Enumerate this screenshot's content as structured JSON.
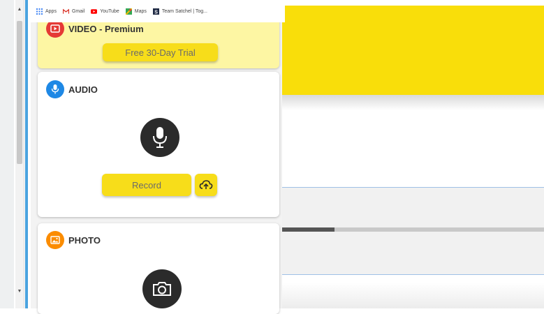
{
  "bookmarks": [
    {
      "label": "Apps",
      "icon": "apps-grid-icon",
      "color": "#4285f4"
    },
    {
      "label": "Gmail",
      "icon": "gmail-icon",
      "color": "#d93025"
    },
    {
      "label": "YouTube",
      "icon": "youtube-icon",
      "color": "#ff0000"
    },
    {
      "label": "Maps",
      "icon": "maps-icon",
      "color": "#34a853"
    },
    {
      "label": "Team Satchel | Tog...",
      "icon": "satchel-icon",
      "color": "#1f2a44"
    }
  ],
  "video": {
    "title": "VIDEO - Premium",
    "trial_button": "Free 30-Day Trial",
    "icon": "video-icon",
    "icon_color": "#e53935"
  },
  "audio": {
    "title": "AUDIO",
    "record_button": "Record",
    "icon": "microphone-icon",
    "icon_color": "#1e88e5",
    "upload_icon": "cloud-upload-icon"
  },
  "photo": {
    "title": "PHOTO",
    "icon": "image-icon",
    "icon_color": "#fb8c00",
    "camera_icon": "camera-icon"
  },
  "colors": {
    "accent_yellow": "#f9de0a",
    "card_video_bg": "#fdf6a3",
    "button_yellow": "#f7dd1a"
  },
  "progress": {
    "fraction": 0.2
  }
}
